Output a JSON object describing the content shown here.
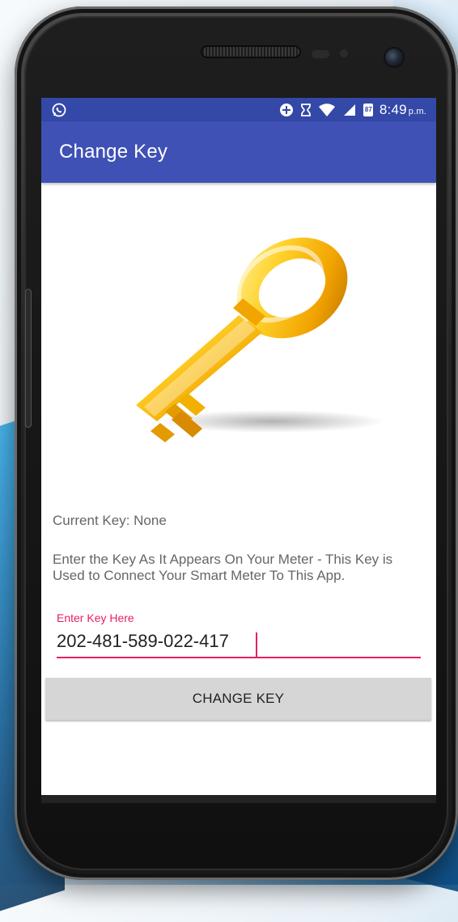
{
  "status_bar": {
    "time": "8:49",
    "ampm": "p.m.",
    "battery_level": "87",
    "icons": [
      "whatsapp-icon",
      "data-saver-icon",
      "hourglass-icon",
      "wifi-icon",
      "cell-signal-icon",
      "battery-icon"
    ]
  },
  "app_bar": {
    "title": "Change Key"
  },
  "content": {
    "current_key_text": "Current Key: None",
    "instructions": "Enter the Key As It Appears On Your Meter - This Key is Used to Connect Your Smart Meter To This App.",
    "input": {
      "label": "Enter Key Here",
      "value": "202-481-589-022-417"
    },
    "button_label": "CHANGE KEY"
  },
  "colors": {
    "status_bar": "#3448a8",
    "app_bar": "#3f51b5",
    "accent": "#e91e63",
    "button": "#d6d6d6"
  }
}
